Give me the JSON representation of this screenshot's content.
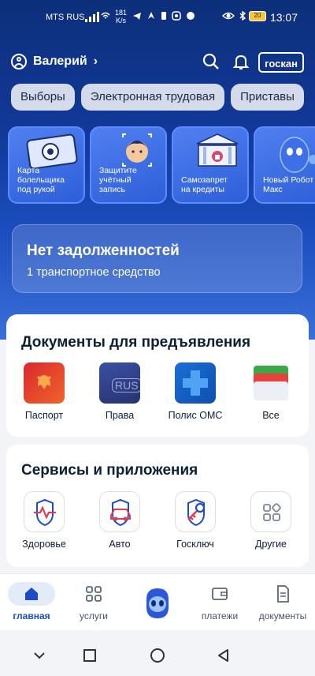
{
  "status_bar": {
    "operator": "MTS RUS",
    "net_speed": "181",
    "net_unit": "K/s",
    "battery": "20",
    "time": "13:07"
  },
  "header": {
    "user_name": "Валерий",
    "scan_label": "госкан"
  },
  "chips": [
    "Выборы",
    "Электронная трудовая",
    "Приставы"
  ],
  "promo_cards": [
    {
      "label": "Карта\nболельщика\nпод рукой"
    },
    {
      "label": "Защитите\nучётный\nзапись"
    },
    {
      "label": "Самозапрет\nна кредиты"
    },
    {
      "label": "Новый Робот\nМакс"
    }
  ],
  "debt": {
    "title": "Нет задолженностей",
    "subtitle": "1 транспортное средство"
  },
  "documents": {
    "title": "Документы для предъявления",
    "items": [
      {
        "label": "Паспорт",
        "icon": "passport-icon"
      },
      {
        "label": "Права",
        "icon": "license-icon",
        "badge": "RUS"
      },
      {
        "label": "Полис ОМС",
        "icon": "oms-icon"
      },
      {
        "label": "Все",
        "icon": "all-documents-icon"
      }
    ]
  },
  "services": {
    "title": "Сервисы и приложения",
    "items": [
      {
        "label": "Здоровье",
        "icon": "health-icon"
      },
      {
        "label": "Авто",
        "icon": "car-icon"
      },
      {
        "label": "Госключ",
        "icon": "key-icon"
      },
      {
        "label": "Другие",
        "icon": "grid-icon"
      }
    ]
  },
  "bottom_nav": [
    {
      "label": "главная",
      "icon": "home-icon",
      "active": true
    },
    {
      "label": "услуги",
      "icon": "services-icon",
      "active": false
    },
    {
      "label": "",
      "icon": "robot-icon",
      "active": false
    },
    {
      "label": "платежи",
      "icon": "wallet-icon",
      "active": false
    },
    {
      "label": "документы",
      "icon": "document-icon",
      "active": false
    }
  ],
  "colors": {
    "brand_blue": "#1c4cc4",
    "hero_dark": "#0d2f7a",
    "text_dark": "#0b1f35"
  }
}
